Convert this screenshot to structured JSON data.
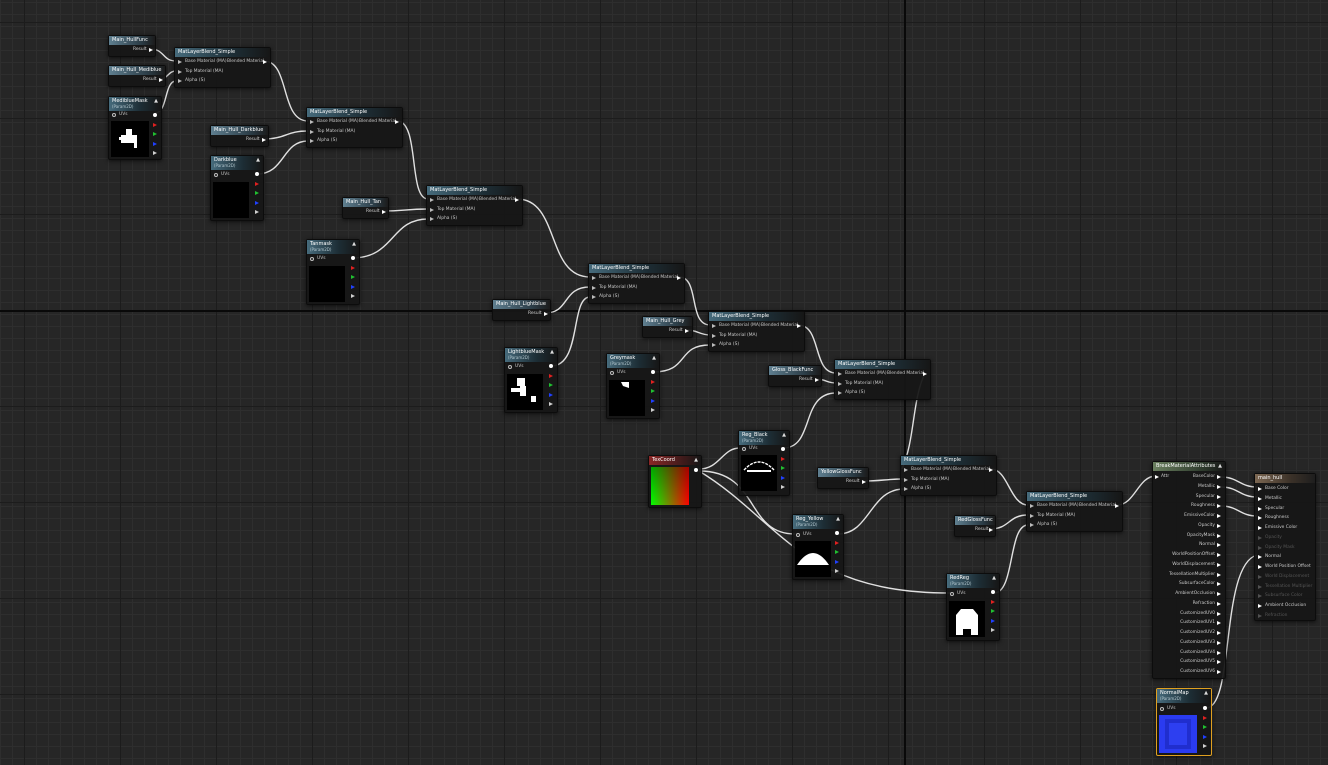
{
  "graph": {
    "function_calls": {
      "main_hull_func": {
        "title": "Main_HullFunc",
        "output": "Result"
      },
      "main_hull_mediblue": {
        "title": "Main_Hull_Mediblue",
        "output": "Result"
      },
      "main_hull_darkblue": {
        "title": "Main_Hull_Darkblue",
        "output": "Result"
      },
      "main_hull_tan": {
        "title": "Main_Hull_Tan",
        "output": "Result"
      },
      "main_hull_lightblue": {
        "title": "Main_Hull_Lightblue",
        "output": "Result"
      },
      "main_hull_grey": {
        "title": "Main_Hull_Grey",
        "output": "Result"
      },
      "gloss_black_func": {
        "title": "Gloss_BlackFunc",
        "output": "Result"
      },
      "yellow_gloss_func": {
        "title": "YellowGlossFunc",
        "output": "Result"
      },
      "red_gloss_func": {
        "title": "RedGlossFunc",
        "output": "Result"
      }
    },
    "blend_node": {
      "title": "MatLayerBlend_Simple",
      "input_base": "Base Material (MA)",
      "input_top": "Top Material (MA)",
      "input_alpha": "Alpha (S)",
      "output": "Blended Material"
    },
    "textures": {
      "mediblue_mask": {
        "title": "MediblueMask",
        "subtitle": "(Param2D)",
        "input": "UVs"
      },
      "darkblue": {
        "title": "Darkblue",
        "subtitle": "(Param2D)",
        "input": "UVs"
      },
      "tan_mask": {
        "title": "Tanmask",
        "subtitle": "(Param2D)",
        "input": "UVs"
      },
      "lightblue_mask": {
        "title": "LightblueMask",
        "subtitle": "(Param2D)",
        "input": "UVs"
      },
      "grey_mask": {
        "title": "Greymask",
        "subtitle": "(Param2D)",
        "input": "UVs"
      },
      "reg_black": {
        "title": "Reg_Black",
        "subtitle": "(Param2D)",
        "input": "UVs"
      },
      "reg_yellow": {
        "title": "Reg_Yellow",
        "subtitle": "(Param2D)",
        "input": "UVs"
      },
      "red_reg": {
        "title": "RedReg",
        "subtitle": "(Param2D)",
        "input": "UVs"
      },
      "normal_map": {
        "title": "NormalMap",
        "subtitle": "(Param2D)",
        "input": "UVs"
      }
    },
    "texcoord": {
      "title": "TexCoord"
    },
    "break_attributes": {
      "title": "BreakMaterialAttributes",
      "input": "Attr",
      "outputs": [
        "BaseColor",
        "Metallic",
        "Specular",
        "Roughness",
        "EmissiveColor",
        "Opacity",
        "OpacityMask",
        "Normal",
        "WorldPositionOffset",
        "WorldDisplacement",
        "TessellationMultiplier",
        "SubsurfaceColor",
        "AmbientOcclusion",
        "Refraction",
        "CustomizedUV0",
        "CustomizedUV1",
        "CustomizedUV2",
        "CustomizedUV3",
        "CustomizedUV4",
        "CustomizedUV5",
        "CustomizedUV6"
      ]
    },
    "material_output": {
      "title": "main_hull",
      "pins": [
        {
          "label": "Base Color",
          "active": true
        },
        {
          "label": "Metallic",
          "active": true
        },
        {
          "label": "Specular",
          "active": true
        },
        {
          "label": "Roughness",
          "active": true
        },
        {
          "label": "Emissive Color",
          "active": true
        },
        {
          "label": "Opacity",
          "active": false
        },
        {
          "label": "Opacity Mask",
          "active": false
        },
        {
          "label": "Normal",
          "active": true
        },
        {
          "label": "World Position Offset",
          "active": true
        },
        {
          "label": "World Displacement",
          "active": false
        },
        {
          "label": "Tessellation Multiplier",
          "active": false
        },
        {
          "label": "Subsurface Color",
          "active": false
        },
        {
          "label": "Ambient Occlusion",
          "active": true
        },
        {
          "label": "Refraction",
          "active": false
        }
      ]
    },
    "colors": {
      "canvas": "#262626",
      "wire": "#e0e0e0",
      "texture_header": "#466b7c",
      "selection": "#e0a020"
    }
  }
}
